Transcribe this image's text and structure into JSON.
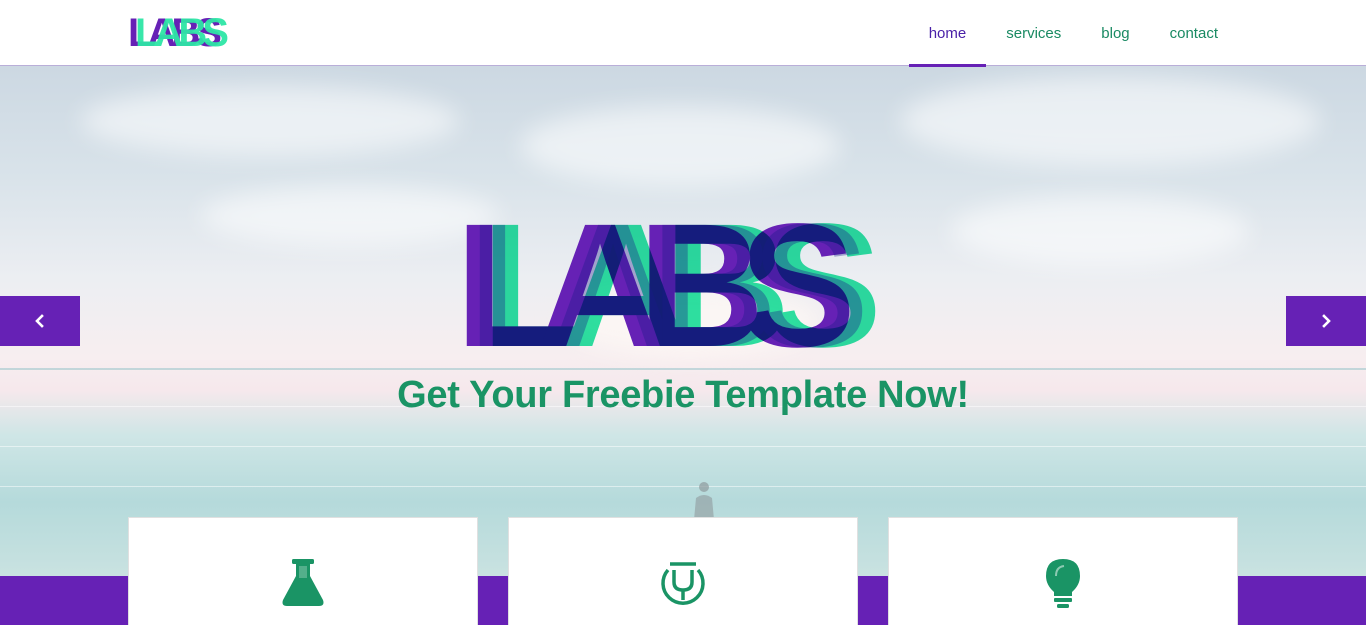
{
  "header": {
    "logo_text": "LABS",
    "nav": [
      {
        "label": "home",
        "active": true
      },
      {
        "label": "services",
        "active": false
      },
      {
        "label": "blog",
        "active": false
      },
      {
        "label": "contact",
        "active": false
      }
    ]
  },
  "hero": {
    "logo_text": "LABS",
    "tagline": "Get Your Freebie Template Now!",
    "prev_icon": "chevron-left-icon",
    "next_icon": "chevron-right-icon"
  },
  "features": [
    {
      "icon": "flask-icon"
    },
    {
      "icon": "magnet-icon"
    },
    {
      "icon": "lightbulb-icon"
    }
  ],
  "colors": {
    "purple": "#6621b5",
    "green": "#2ee6a6",
    "dark_green": "#1a9465",
    "navy": "#1b1a8a"
  }
}
